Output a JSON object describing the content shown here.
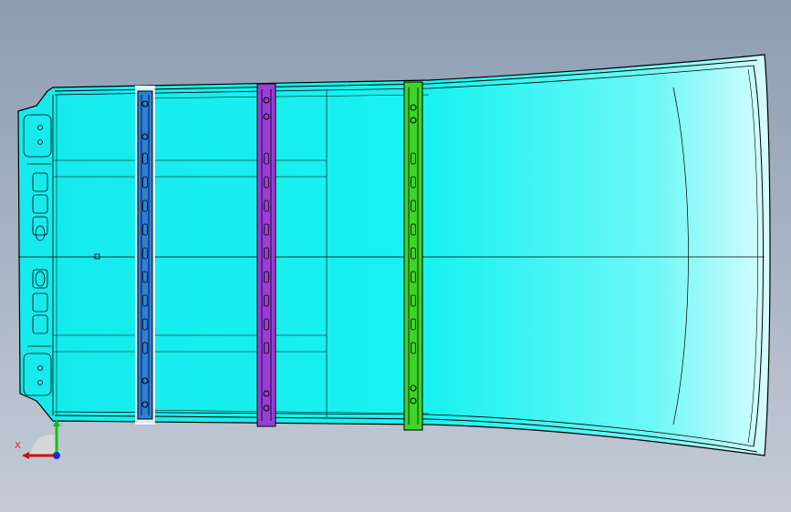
{
  "viewport": {
    "background_top": "#8d9db2",
    "background_bottom": "#c4cbd6"
  },
  "model": {
    "description_color": "#17f0ee",
    "edge_color": "#000000",
    "crossmember_colors": {
      "first": "#2f7fd8",
      "second": "#9a3ed8",
      "third": "#3fd42a"
    }
  },
  "triad": {
    "x_label": "X",
    "x_color": "#d01010",
    "y_color": "#10c010",
    "z_color": "#1030d0",
    "icon": "coordinate-triad-icon"
  }
}
